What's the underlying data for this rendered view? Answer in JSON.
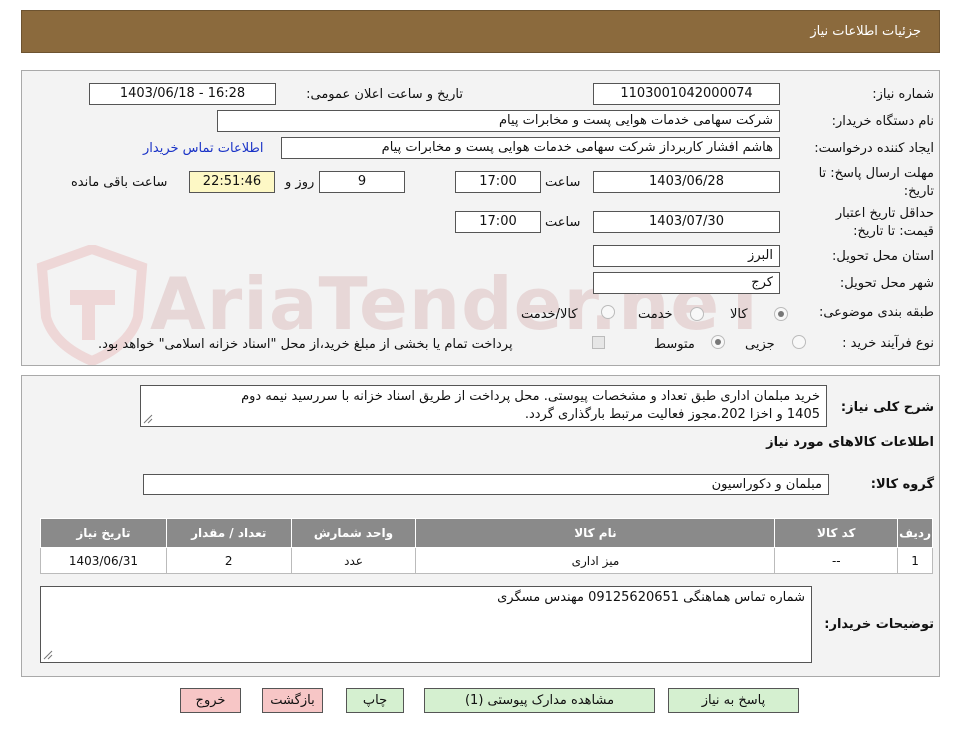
{
  "header": {
    "title": "جزئیات اطلاعات نیاز"
  },
  "form": {
    "need_number_label": "شماره نیاز:",
    "need_number": "1103001042000074",
    "announce_label": "تاریخ و ساعت اعلان عمومی:",
    "announce_value": "1403/06/18 - 16:28",
    "buyer_org_label": "نام دستگاه خریدار:",
    "buyer_org": "شرکت سهامی خدمات هوایی پست و مخابرات پیام",
    "requester_label": "ایجاد کننده درخواست:",
    "requester": "هاشم افشار کاربرداز شرکت سهامی خدمات هوایی پست و مخابرات پیام",
    "contact_link": "اطلاعات تماس خریدار",
    "deadline_label_1": "مهلت ارسال پاسخ: تا",
    "deadline_label_2": "تاریخ:",
    "deadline_date": "1403/06/28",
    "time_label": "ساعت",
    "deadline_time": "17:00",
    "days": "9",
    "days_label": "روز و",
    "remaining_time": "22:51:46",
    "remaining_label": "ساعت باقی مانده",
    "validity_label_1": "حداقل تاریخ اعتبار",
    "validity_label_2": "قیمت: تا تاریخ:",
    "validity_date": "1403/07/30",
    "validity_time": "17:00",
    "province_label": "استان محل تحویل:",
    "province": "البرز",
    "city_label": "شهر محل تحویل:",
    "city": "کرج",
    "category_label": "طبقه بندی موضوعی:",
    "cat_goods": "کالا",
    "cat_service": "خدمت",
    "cat_both": "کالا/خدمت",
    "process_label": "نوع فرآیند خرید :",
    "proc_partial": "جزیی",
    "proc_medium": "متوسط",
    "payment_note": "پرداخت تمام یا بخشی از مبلغ خرید،از محل \"اسناد خزانه اسلامی\" خواهد بود."
  },
  "details": {
    "summary_label": "شرح کلی نیاز:",
    "summary_line1": "خرید مبلمان اداری طبق تعداد و مشخصات پیوستی. محل پرداخت از طریق اسناد خزانه با سررسید نیمه دوم",
    "summary_line2": "1405 و اخزا 202.مجوز فعالیت مرتبط  بارگذاری گردد.",
    "goods_info_title": "اطلاعات کالاهای مورد نیاز",
    "group_label": "گروه کالا:",
    "group_value": "مبلمان و دکوراسیون",
    "table": {
      "headers": [
        "ردیف",
        "کد کالا",
        "نام کالا",
        "واحد شمارش",
        "تعداد / مقدار",
        "تاریخ نیاز"
      ],
      "rows": [
        [
          "1",
          "--",
          "میز اداری",
          "عدد",
          "2",
          "1403/06/31"
        ]
      ]
    },
    "buyer_notes_label": "توضیحات خریدار:",
    "buyer_notes": "شماره تماس هماهنگی 09125620651 مهندس مسگری"
  },
  "buttons": {
    "reply": "پاسخ به نیاز",
    "view_docs": "مشاهده مدارک پیوستی (1)",
    "print": "چاپ",
    "back": "بازگشت",
    "exit": "خروج"
  },
  "watermark": {
    "text": "AriaTender.neT"
  },
  "colors": {
    "header": "#8b6a3d",
    "table_header": "#8a8a8a",
    "btn_green": "#d5f0d0",
    "btn_pink": "#f7c6c6",
    "highlight": "#fdf8c5"
  }
}
